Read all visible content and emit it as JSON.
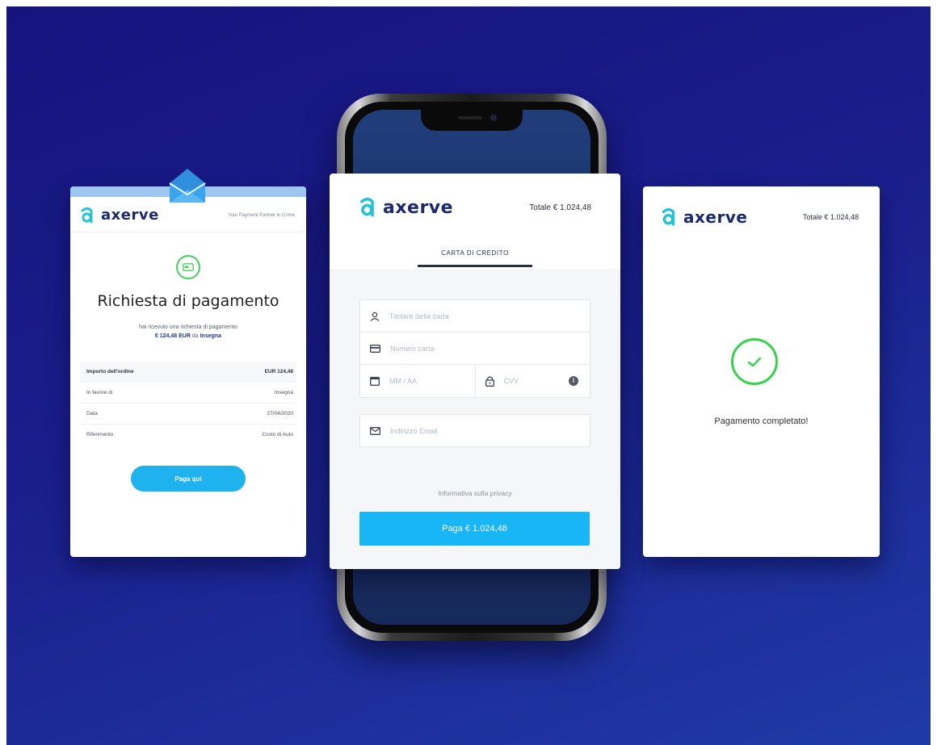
{
  "brand": {
    "name": "axerve",
    "primary_color": "#1a2a6c",
    "accent_color": "#18b6f5",
    "success_color": "#37d24c"
  },
  "email_card": {
    "logo_text": "axerve",
    "header_note": "Your Payment Partner in Crime",
    "icon": "payment-card-icon",
    "title": "Richiesta di pagamento",
    "desc_line1": "hai ricevuto una richiesta di pagamento",
    "desc_amount": "€ 124,48 EUR",
    "desc_from": "da",
    "desc_merchant": "Insegna",
    "rows": [
      {
        "label": "Importo dell'ordine",
        "value": "EUR 124,48"
      },
      {
        "label": "In favore di",
        "value": "Insegna"
      },
      {
        "label": "Data",
        "value": "27/04/2020"
      },
      {
        "label": "Riferimento",
        "value": "Costo di Auto"
      }
    ],
    "button_label": "Paga qui"
  },
  "payment_card": {
    "logo_text": "axerve",
    "total": "Totale € 1.024,48",
    "tab_label": "CARTA DI CREDITO",
    "fields": {
      "cardholder_placeholder": "Titolare della carta",
      "card_number_placeholder": "Numero carta",
      "expiry_placeholder": "MM / AA",
      "cvv_placeholder": "CVV",
      "email_placeholder": "Indirizzo Email"
    },
    "info_symbol": "i",
    "privacy_link": "Informativa sulla privacy",
    "pay_button": "Paga € 1.024,48"
  },
  "success_card": {
    "logo_text": "axerve",
    "total": "Totale € 1.024,48",
    "message": "Pagamento completato!",
    "icon": "check-circle-icon"
  }
}
